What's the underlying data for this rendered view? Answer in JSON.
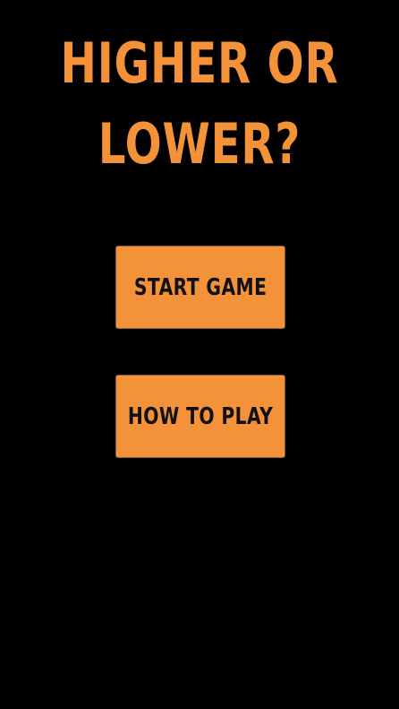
{
  "game": {
    "title_line1": "HIGHER OR",
    "title_line2": "LOWER?"
  },
  "menu": {
    "start_label": "START GAME",
    "howto_label": "HOW TO PLAY"
  },
  "colors": {
    "accent": "#f39238",
    "background": "#000000",
    "button_text": "#111111"
  }
}
